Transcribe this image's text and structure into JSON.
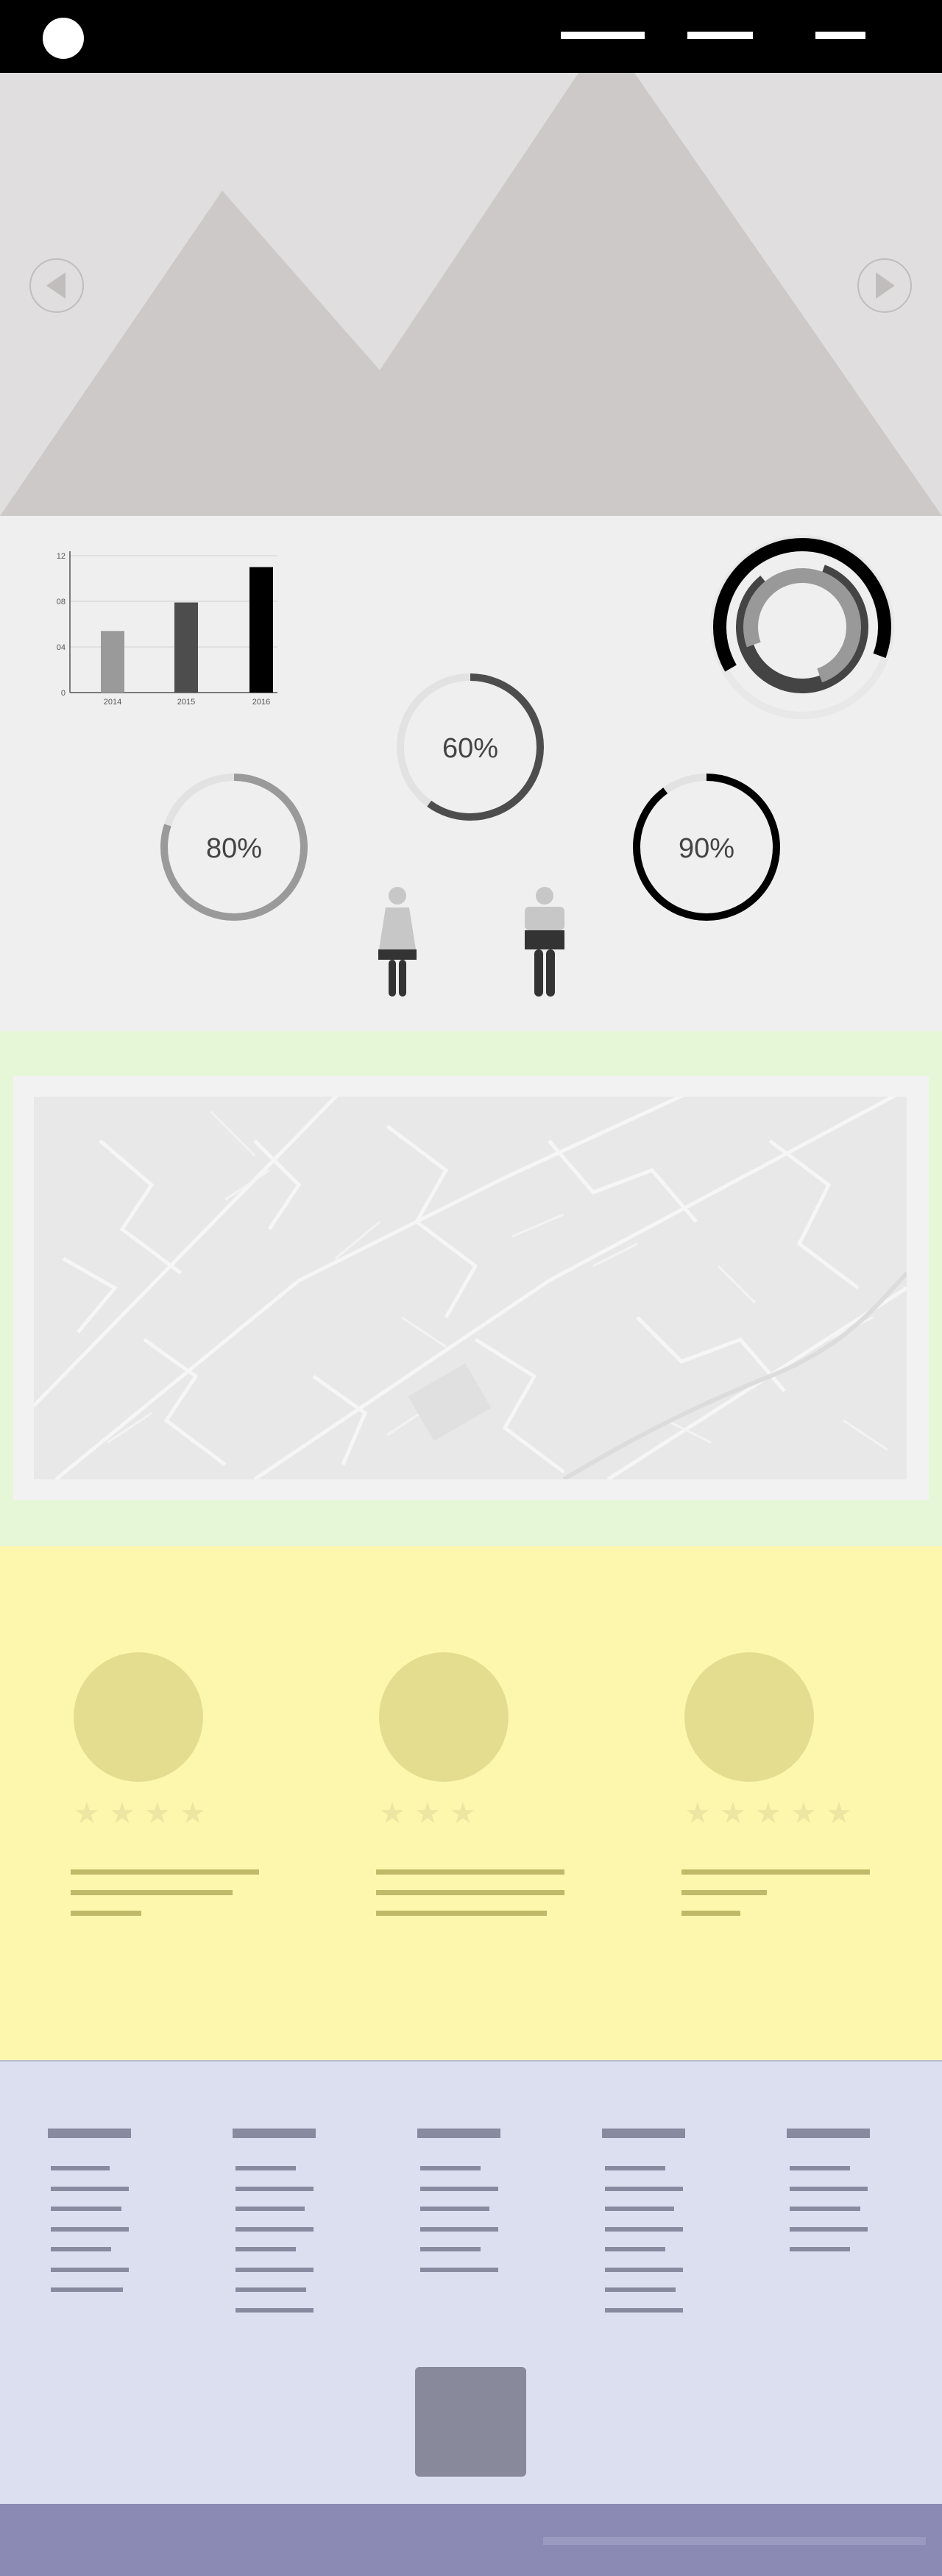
{
  "colors": {
    "header_bg": "#000000",
    "hero_bg": "#e0dede",
    "stats_bg": "#efefef",
    "map_bg": "#e6f7d8",
    "testimonials_bg": "#fdf7ae",
    "links_bg": "#dcdff0",
    "bottom_bar_bg": "#8b8ab4"
  },
  "header": {
    "logo": "circle-logo",
    "nav_items": [
      "menu-item-1",
      "menu-item-2",
      "menu-item-3"
    ]
  },
  "hero": {
    "image": "mountain-placeholder",
    "prev_icon": "chevron-left-icon",
    "next_icon": "chevron-right-icon"
  },
  "stats": {
    "bar_chart": {
      "y_ticks": [
        "12",
        "08",
        "04",
        "0"
      ],
      "categories": [
        "2014",
        "2015",
        "2016"
      ]
    },
    "progress_60": {
      "label": "60%",
      "value": 0.6
    },
    "progress_80": {
      "label": "80%",
      "value": 0.8
    },
    "progress_90": {
      "label": "90%",
      "value": 0.9
    },
    "icons": [
      "female-icon",
      "male-icon"
    ]
  },
  "chart_data": {
    "type": "bar",
    "categories": [
      "2014",
      "2015",
      "2016"
    ],
    "values": [
      5.4,
      7.9,
      11
    ],
    "ylim": [
      0,
      12
    ],
    "yticks": [
      0,
      4,
      8,
      12
    ],
    "grid": true
  },
  "map": {
    "image": "street-map-placeholder"
  },
  "testimonials": [
    {
      "avatar": "avatar-placeholder",
      "stars": 4
    },
    {
      "avatar": "avatar-placeholder",
      "stars": 3
    },
    {
      "avatar": "avatar-placeholder",
      "stars": 5
    }
  ],
  "footer": {
    "columns": 5,
    "cta_icon": "square-button"
  }
}
